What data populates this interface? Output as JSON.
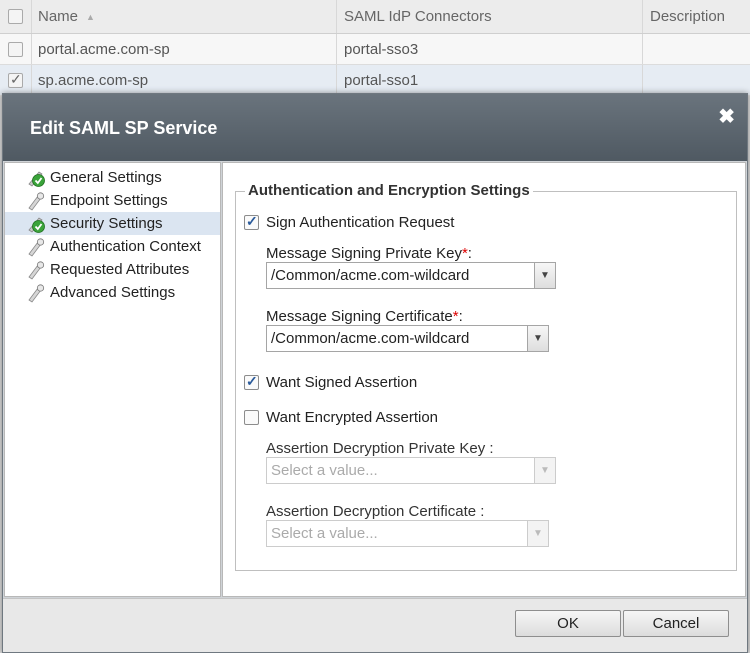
{
  "table": {
    "columns": [
      "Name",
      "SAML IdP Connectors",
      "Description"
    ],
    "rows": [
      {
        "name": "portal.acme.com-sp",
        "idp": "portal-sso3",
        "description": "",
        "checked": false
      },
      {
        "name": "sp.acme.com-sp",
        "idp": "portal-sso1",
        "description": "",
        "checked": true
      }
    ]
  },
  "dialog": {
    "title": "Edit SAML SP Service",
    "close_icon": "close-icon",
    "nav": [
      {
        "label": "General Settings",
        "icon": "check-badge-icon",
        "selected": false
      },
      {
        "label": "Endpoint Settings",
        "icon": "wrench-icon",
        "selected": false
      },
      {
        "label": "Security Settings",
        "icon": "check-badge-icon",
        "selected": true
      },
      {
        "label": "Authentication Context",
        "icon": "wrench-icon",
        "selected": false
      },
      {
        "label": "Requested Attributes",
        "icon": "wrench-icon",
        "selected": false
      },
      {
        "label": "Advanced Settings",
        "icon": "wrench-icon",
        "selected": false
      }
    ],
    "section_title": "Authentication and Encryption Settings",
    "sign_auth_request": {
      "label": "Sign Authentication Request",
      "checked": true
    },
    "msg_signing_key": {
      "label": "Message Signing Private Key",
      "required": "*",
      "suffix": ":",
      "value": "/Common/acme.com-wildcard"
    },
    "msg_signing_cert": {
      "label": "Message Signing Certificate",
      "required": "*",
      "suffix": ":",
      "value": "/Common/acme.com-wildcard"
    },
    "want_signed_assertion": {
      "label": "Want Signed Assertion",
      "checked": true
    },
    "want_encrypted_assertion": {
      "label": "Want Encrypted Assertion",
      "checked": false
    },
    "assertion_decrypt_key": {
      "label": "Assertion Decryption Private Key",
      "suffix": " :",
      "placeholder": "Select a value..."
    },
    "assertion_decrypt_cert": {
      "label": "Assertion Decryption Certificate",
      "suffix": " :",
      "placeholder": "Select a value..."
    },
    "buttons": {
      "ok": "OK",
      "cancel": "Cancel"
    }
  }
}
